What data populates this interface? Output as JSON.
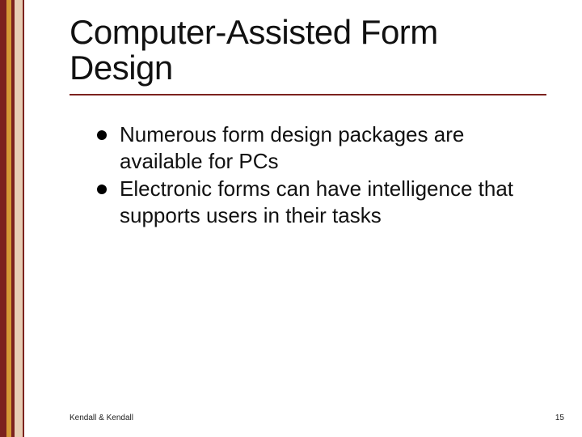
{
  "title": "Computer-Assisted Form Design",
  "bullets": [
    "Numerous form design packages are available for PCs",
    "Electronic forms can have intelligence that supports users in their tasks"
  ],
  "footer": {
    "left": "Kendall & Kendall",
    "page": "15"
  },
  "colors": {
    "rule": "#7c221e"
  }
}
